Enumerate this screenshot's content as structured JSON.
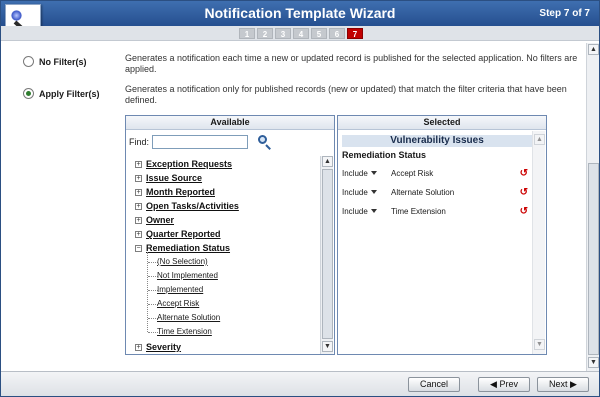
{
  "window": {
    "title": "Notification Template Wizard",
    "step_label": "Step 7 of 7",
    "steps": [
      "1",
      "2",
      "3",
      "4",
      "5",
      "6",
      "7"
    ],
    "active_step": "7"
  },
  "filters": {
    "no_filter_label": "No Filter(s)",
    "no_filter_desc": "Generates a notification each time a new or updated record is published for the selected application. No filters are applied.",
    "apply_filter_label": "Apply Filter(s)",
    "apply_filter_desc": "Generates a notification only for published records (new or updated) that match the filter criteria that have been defined.",
    "selected_option": "Apply Filter(s)"
  },
  "available": {
    "header": "Available",
    "find_label": "Find:",
    "find_value": "",
    "tree": [
      {
        "label": "Exception Requests",
        "expanded": false
      },
      {
        "label": "Issue Source",
        "expanded": false
      },
      {
        "label": "Month Reported",
        "expanded": false
      },
      {
        "label": "Open Tasks/Activities",
        "expanded": false
      },
      {
        "label": "Owner",
        "expanded": false
      },
      {
        "label": "Quarter Reported",
        "expanded": false
      },
      {
        "label": "Remediation Status",
        "expanded": true
      },
      {
        "label": "Severity",
        "expanded": false
      }
    ],
    "remediation_children": [
      "(No Selection)",
      "Not Implemented",
      "Implemented",
      "Accept Risk",
      "Alternate Solution",
      "Time Extension"
    ]
  },
  "selected": {
    "header": "Selected",
    "group": "Vulnerability Issues",
    "section": "Remediation Status",
    "rows": [
      {
        "mode": "Include",
        "value": "Accept Risk"
      },
      {
        "mode": "Include",
        "value": "Alternate Solution"
      },
      {
        "mode": "Include",
        "value": "Time Extension"
      }
    ]
  },
  "footer": {
    "cancel_label": "Cancel",
    "prev_label": "◀ Prev",
    "next_label": "Next ▶"
  },
  "colors": {
    "titlebar": "#2f5e9e",
    "active_step": "#c00000",
    "selected_radio": "#2f7d2f",
    "remove_icon": "#cc0000"
  },
  "icons": [
    "wizard-wand-icon",
    "search-icon",
    "expand-icon",
    "collapse-icon",
    "undo-remove-icon",
    "scroll-up-icon",
    "scroll-down-icon"
  ]
}
